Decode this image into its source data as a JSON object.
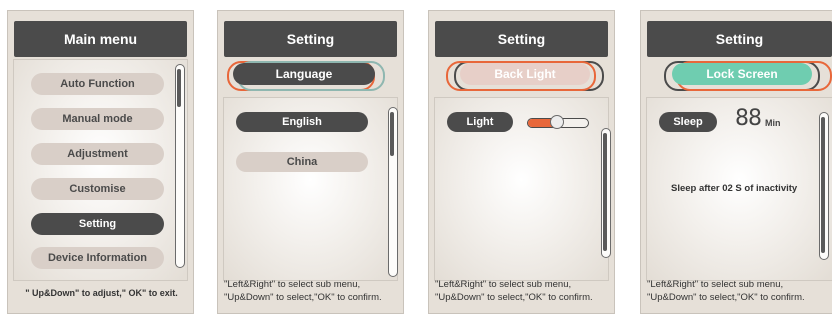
{
  "panels": [
    {
      "title": "Main menu",
      "items": [
        "Auto Function",
        "Manual mode",
        "Adjustment",
        "Customise",
        "Setting",
        "Device Information"
      ],
      "selected_index": 4,
      "footer": "\" Up&Down\" to adjust,\" OK\" to exit."
    },
    {
      "title": "Setting",
      "subtitle": "Language",
      "options": [
        "English",
        "China"
      ],
      "selected_index": 0,
      "footer_line1": "\"Left&Right\" to select sub menu,",
      "footer_line2": "\"Up&Down\" to select,\"OK\" to confirm."
    },
    {
      "title": "Setting",
      "subtitle": "Back Light",
      "light_label": "Light",
      "footer_line1": "\"Left&Right\" to select sub menu,",
      "footer_line2": "\"Up&Down\" to select,\"OK\" to confirm."
    },
    {
      "title": "Setting",
      "subtitle": "Lock Screen",
      "sleep_label": "Sleep",
      "sleep_value": "88",
      "sleep_unit": "Min",
      "message": "Sleep after 02 S of inactivity",
      "footer_line1": "\"Left&Right\" to select sub menu,",
      "footer_line2": "\"Up&Down\" to select,\"OK\" to confirm."
    }
  ],
  "colors": {
    "dark": "#4b4b4b",
    "pill_light": "#d9cfc8",
    "accent_orange": "#e8673a",
    "accent_teal": "#6fcdb0",
    "accent_pink": "#e7cfc8"
  }
}
